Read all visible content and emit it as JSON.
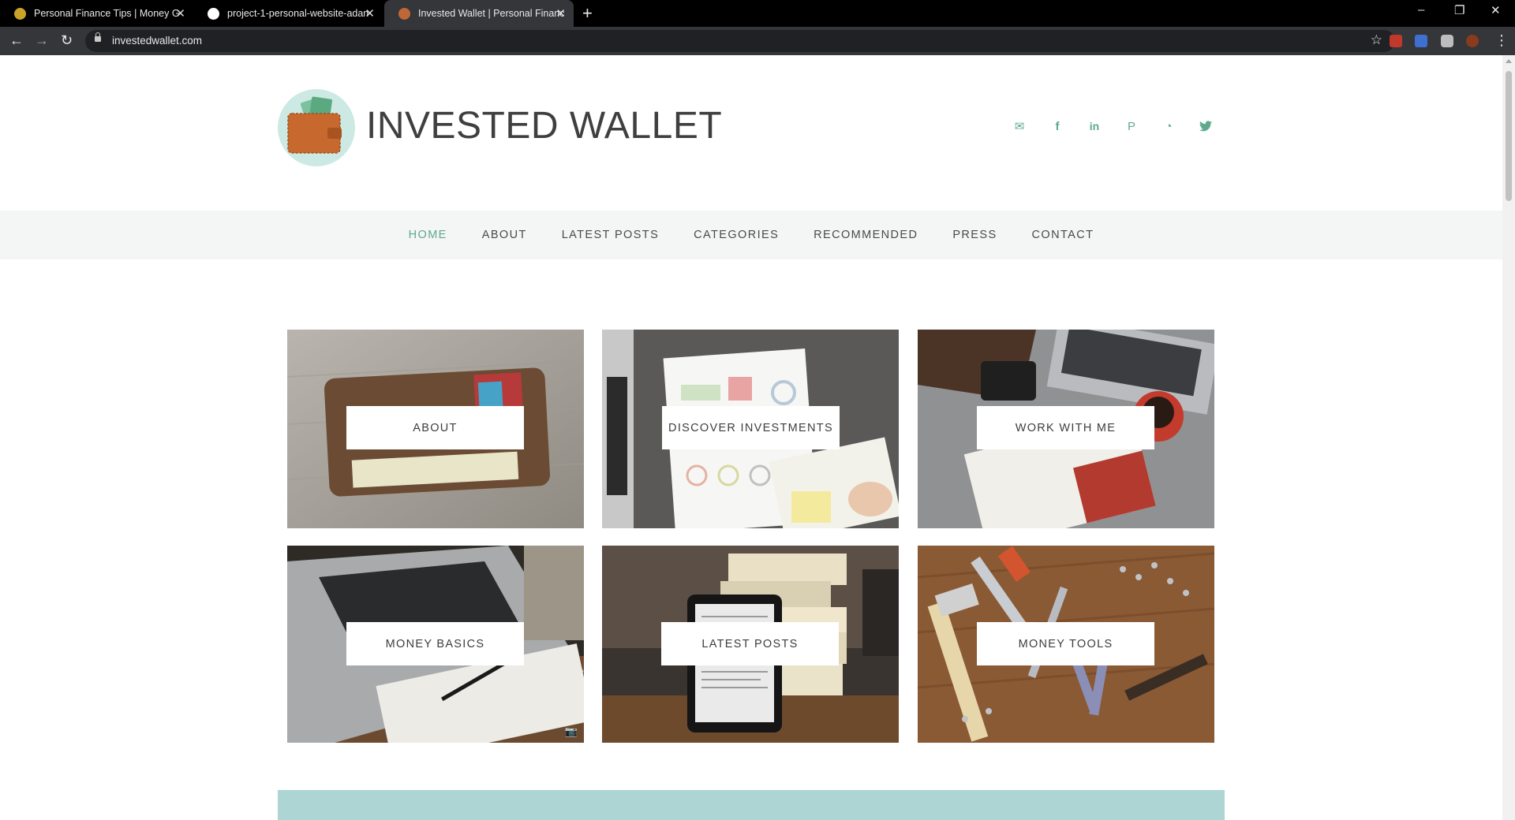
{
  "browser": {
    "tabs": [
      {
        "title": "Personal Finance Tips | Money G",
        "favicon_color": "#c9a227"
      },
      {
        "title": "project-1-personal-website-adan",
        "favicon_color": "#ffffff"
      },
      {
        "title": "Invested Wallet | Personal Financ",
        "favicon_color": "#c0673a"
      }
    ],
    "new_tab_icon": "+",
    "url": "investedwallet.com",
    "window_controls": {
      "minimize": "–",
      "restore": "❐",
      "close": "✕"
    }
  },
  "site": {
    "title": "INVESTED WALLET",
    "accent_color": "#5fa98c",
    "social_icons": [
      "email-icon",
      "facebook-icon",
      "linkedin-icon",
      "pinterest-icon",
      "rss-icon",
      "twitter-icon"
    ],
    "social_glyphs": {
      "email": "✉",
      "facebook": "f",
      "linkedin": "in",
      "pinterest": "P",
      "rss": "◔",
      "twitter": "🐦"
    }
  },
  "nav": {
    "items": [
      "HOME",
      "ABOUT",
      "LATEST POSTS",
      "CATEGORIES",
      "RECOMMENDED",
      "PRESS",
      "CONTACT"
    ],
    "active": "HOME"
  },
  "tiles": [
    {
      "label": "ABOUT"
    },
    {
      "label": "DISCOVER INVESTMENTS"
    },
    {
      "label": "WORK WITH ME"
    },
    {
      "label": "MONEY BASICS"
    },
    {
      "label": "LATEST POSTS"
    },
    {
      "label": "MONEY TOOLS"
    }
  ]
}
